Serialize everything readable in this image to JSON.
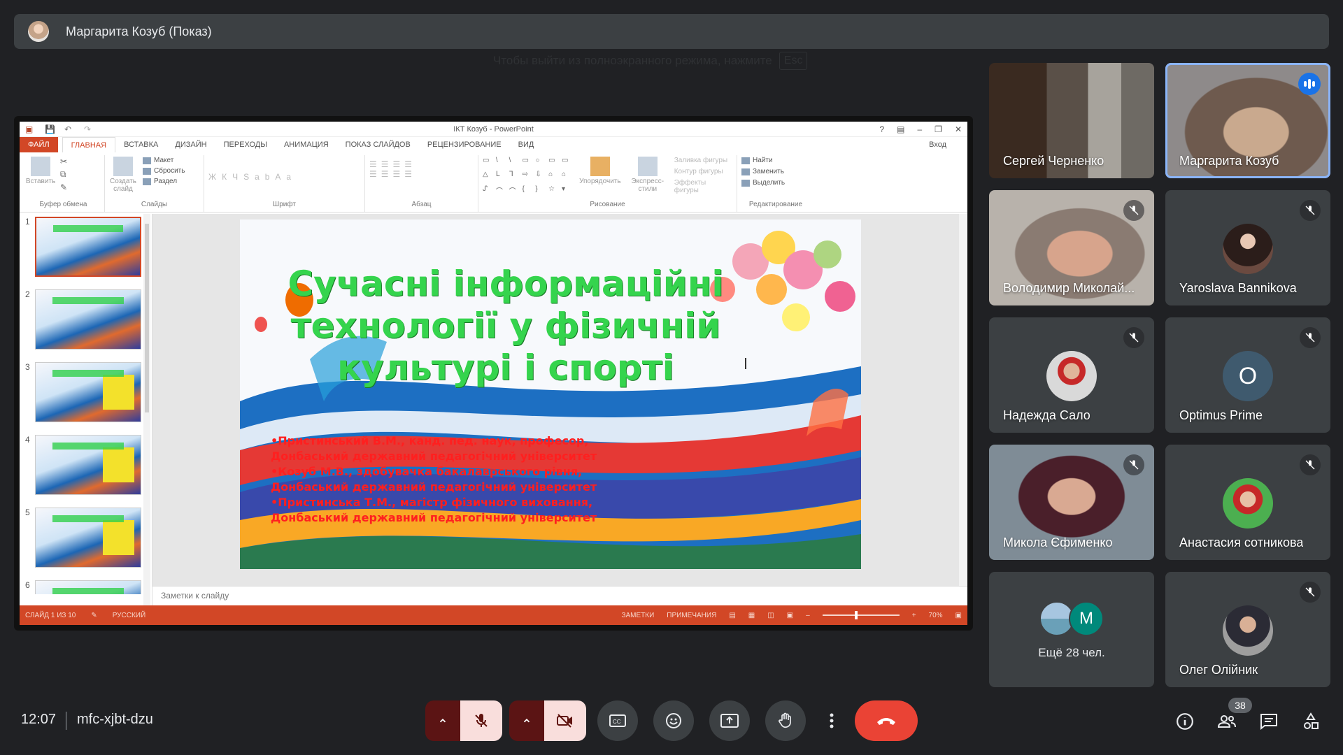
{
  "presenter": {
    "name": "Маргарита Козуб (Показ)"
  },
  "fullscreen_hint": {
    "text": "Чтобы выйти из полноэкранного режима, нажмите",
    "key": "Esc"
  },
  "ppt": {
    "title": "ІКТ Козуб - PowerPoint",
    "tabs": [
      "ФАЙЛ",
      "ГЛАВНАЯ",
      "ВСТАВКА",
      "ДИЗАЙН",
      "ПЕРЕХОДЫ",
      "АНИМАЦИЯ",
      "ПОКАЗ СЛАЙДОВ",
      "РЕЦЕНЗИРОВАНИЕ",
      "ВИД"
    ],
    "sign_in": "Вход",
    "ribbon": {
      "clipboard": {
        "paste": "Вставить",
        "label": "Буфер обмена"
      },
      "slides": {
        "new_slide": "Создать слайд",
        "layout": "Макет",
        "reset": "Сбросить",
        "section": "Раздел",
        "label": "Слайды"
      },
      "font": {
        "label": "Шрифт"
      },
      "paragraph": {
        "label": "Абзац"
      },
      "drawing": {
        "arrange": "Упорядочить",
        "styles": "Экспресс-стили",
        "fill": "Заливка фигуры",
        "outline": "Контур фигуры",
        "effects": "Эффекты фигуры",
        "label": "Рисование"
      },
      "editing": {
        "find": "Найти",
        "replace": "Заменить",
        "select": "Выделить",
        "label": "Редактирование"
      }
    },
    "thumbnail_numbers": [
      "1",
      "2",
      "3",
      "4",
      "5",
      "6"
    ],
    "slide": {
      "title_lines": [
        "Сучасні інформаційні",
        "технології у фізичній",
        "культурі і спорті"
      ],
      "authors": [
        "•Пристинський В.М., канд. пед. наук, професор,",
        "Донбаський державний педагогічний університет",
        "•Козуб М.В., здобувачка бакалаврського рівня,",
        "Донбаський державний педагогічний університет",
        "•Пристинська Т.М., магістр фізичного виховання,",
        "Донбаський державний педагогічний університет"
      ]
    },
    "notes_placeholder": "Заметки к слайду",
    "status": {
      "slide": "СЛАЙД 1 ИЗ 10",
      "lang": "РУССКИЙ",
      "notes": "ЗАМЕТКИ",
      "comments": "ПРИМЕЧАНИЯ",
      "zoom": "70%"
    }
  },
  "participants": [
    {
      "name": "Сергей Черненко",
      "muted": false
    },
    {
      "name": "Маргарита Козуб",
      "speaking": true
    },
    {
      "name": "Володимир Миколай...",
      "muted": true
    },
    {
      "name": "Yaroslava Bannikova",
      "muted": true
    },
    {
      "name": "Надежда Сало",
      "muted": true
    },
    {
      "name": "Optimus Prime",
      "muted": true,
      "avatar_letter": "O"
    },
    {
      "name": "Микола Єфименко",
      "muted": true
    },
    {
      "name": "Анастасия сотникова",
      "muted": true
    },
    {
      "name": "Ещё 28 чел.",
      "avatar_letter": "M"
    },
    {
      "name": "Олег Олійник",
      "muted": true
    }
  ],
  "bottom": {
    "time": "12:07",
    "meeting_code": "mfc-xjbt-dzu",
    "participant_count": "38"
  },
  "colors": {
    "background": "#202124",
    "tile": "#3c4043",
    "accent": "#8ab4f8",
    "end_call": "#ea4335",
    "ppt_orange": "#d24726"
  }
}
